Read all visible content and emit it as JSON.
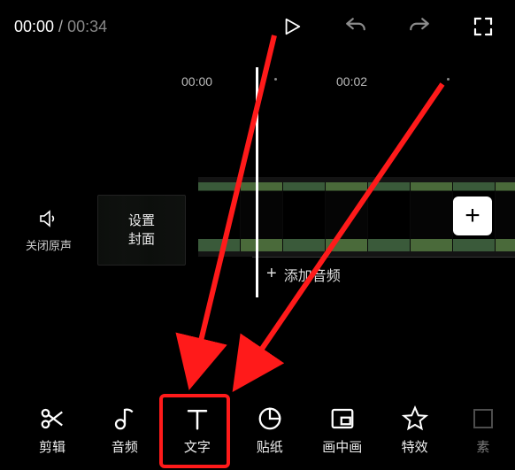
{
  "time": {
    "current": "00:00",
    "separator": " / ",
    "total": "00:34"
  },
  "ruler": {
    "t1": "00:00",
    "t2": "00:02"
  },
  "mute": {
    "label": "关闭原声"
  },
  "cover": {
    "label_line1": "设置",
    "label_line2": "封面"
  },
  "add_clip": {
    "symbol": "+"
  },
  "add_audio": {
    "plus": "+",
    "label": "添加音频"
  },
  "toolbar": {
    "edit": {
      "label": "剪辑"
    },
    "audio": {
      "label": "音频"
    },
    "text": {
      "label": "文字"
    },
    "sticker": {
      "label": "贴纸"
    },
    "pip": {
      "label": "画中画"
    },
    "effect": {
      "label": "特效"
    },
    "extra": {
      "label": "素"
    }
  }
}
